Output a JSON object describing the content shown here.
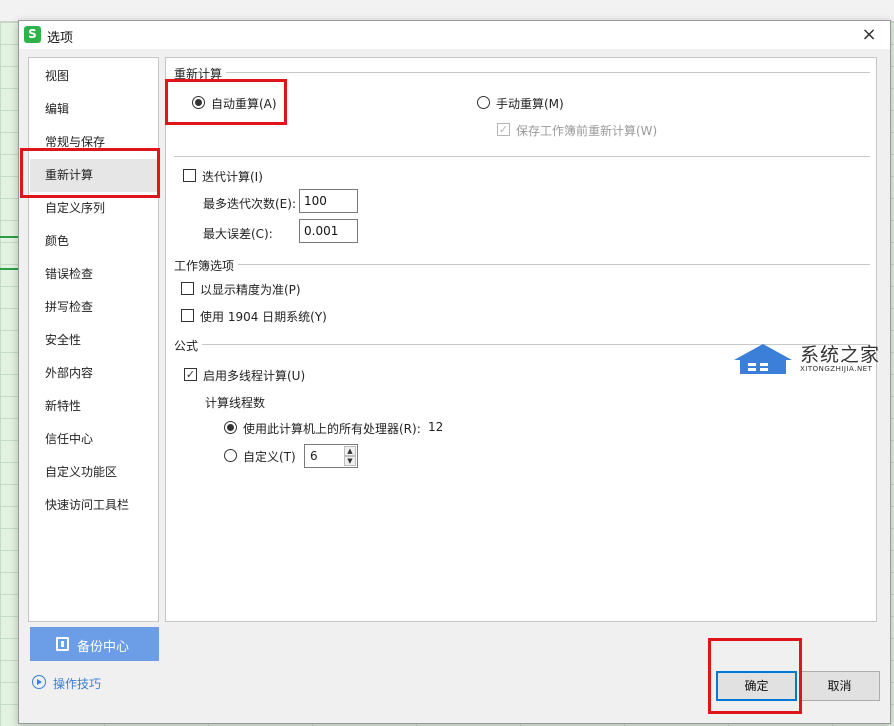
{
  "dialog": {
    "title": "选项",
    "app_logo": "S",
    "close_glyph": "×"
  },
  "sidebar": {
    "items": [
      {
        "label": "视图"
      },
      {
        "label": "编辑"
      },
      {
        "label": "常规与保存"
      },
      {
        "label": "重新计算",
        "active": true
      },
      {
        "label": "自定义序列"
      },
      {
        "label": "颜色"
      },
      {
        "label": "错误检查"
      },
      {
        "label": "拼写检查"
      },
      {
        "label": "安全性"
      },
      {
        "label": "外部内容"
      },
      {
        "label": "新特性"
      },
      {
        "label": "信任中心"
      },
      {
        "label": "自定义功能区"
      },
      {
        "label": "快速访问工具栏"
      }
    ],
    "backup_center": "备份中心",
    "tips_link": "操作技巧"
  },
  "recalc": {
    "section_title": "重新计算",
    "auto_label": "自动重算(A)",
    "auto_selected": true,
    "manual_label": "手动重算(M)",
    "manual_selected": false,
    "save_before_label": "保存工作簿前重新计算(W)",
    "save_before_checked": true,
    "save_before_disabled": true
  },
  "iteration": {
    "enable_label": "迭代计算(I)",
    "enabled": false,
    "max_iter_label": "最多迭代次数(E):",
    "max_iter_value": "100",
    "max_change_label": "最大误差(C):",
    "max_change_value": "0.001"
  },
  "workbook": {
    "section_title": "工作簿选项",
    "precision_label": "以显示精度为准(P)",
    "precision_checked": false,
    "date1904_label": "使用 1904 日期系统(Y)",
    "date1904_checked": false
  },
  "formula": {
    "section_title": "公式",
    "multithread_label": "启用多线程计算(U)",
    "multithread_checked": true,
    "threads_title": "计算线程数",
    "use_all_label": "使用此计算机上的所有处理器(R):",
    "use_all_count": "12",
    "use_all_selected": true,
    "custom_label": "自定义(T)",
    "custom_selected": false,
    "custom_value": "6"
  },
  "buttons": {
    "ok": "确定",
    "cancel": "取消"
  },
  "watermark": {
    "text": "系统之家",
    "sub": "XITONGZHIJIA.NET"
  },
  "icons": {
    "close": "close-icon",
    "backup": "backup-icon",
    "tips": "play-circle-icon",
    "check": "✓"
  },
  "colors": {
    "accent_blue": "#0078d7",
    "backup_button": "#6c9ee8",
    "link": "#3b7fd9",
    "highlight_red": "#e0141b",
    "app_green": "#2eb34a"
  }
}
